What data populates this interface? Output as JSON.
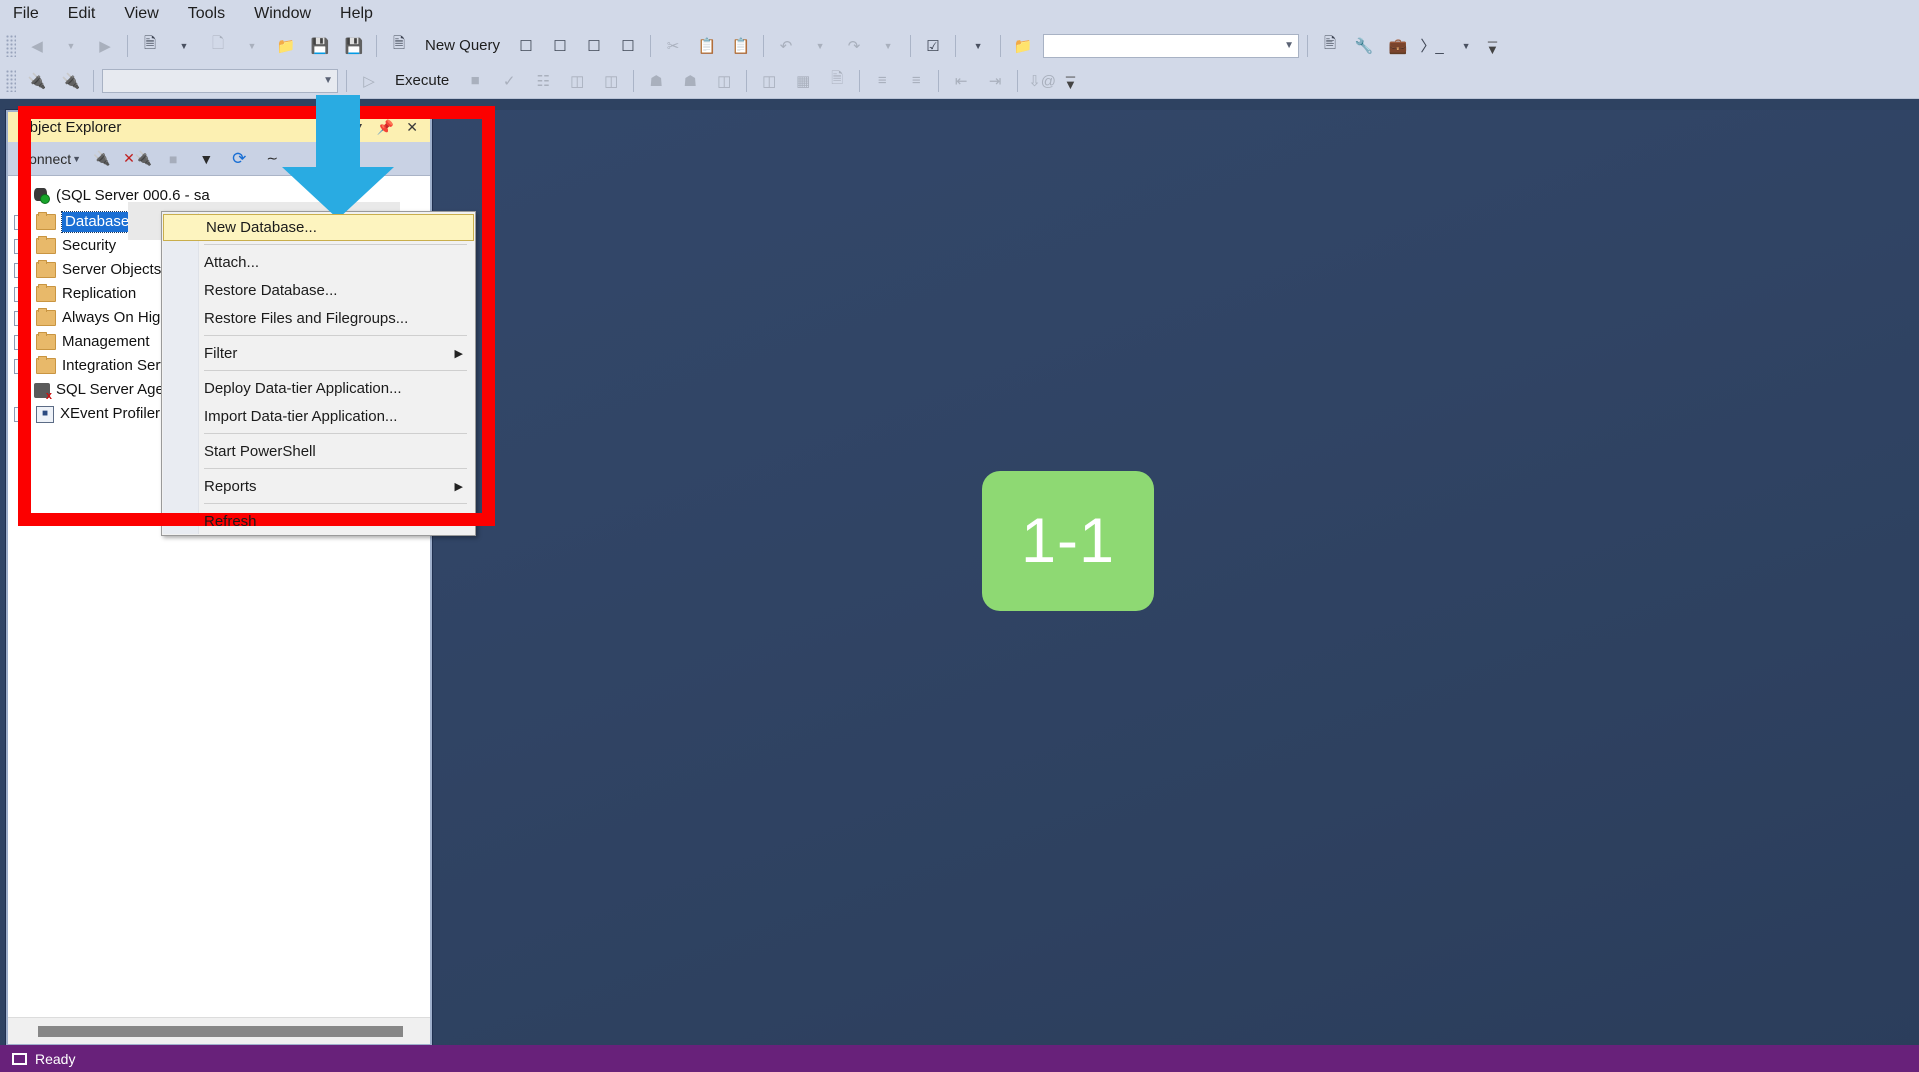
{
  "menubar": {
    "items": [
      "File",
      "Edit",
      "View",
      "Tools",
      "Window",
      "Help"
    ]
  },
  "toolbar_row1": {
    "new_query_label": "New Query",
    "icons": [
      "back-arrow-icon",
      "forward-arrow-icon",
      "new-project-icon",
      "new-item-icon",
      "open-file-icon",
      "save-icon",
      "save-all-icon",
      "new-query-icon",
      "mdx-query-icon",
      "dmx-query-icon",
      "xmla-query-icon",
      "dax-query-icon",
      "cut-icon",
      "copy-icon",
      "paste-icon",
      "undo-icon",
      "redo-icon",
      "solution-explorer-icon",
      "find-icon"
    ],
    "search_value": "",
    "right_icons": [
      "visual-studio-window-icon",
      "tools-wrench-icon",
      "toolbox-icon",
      "command-prompt-icon"
    ]
  },
  "toolbar_row2": {
    "execute_label": "Execute",
    "database_combo_value": "",
    "icons": [
      "connect-icon",
      "disconnect-icon",
      "execute-icon",
      "stop-icon",
      "parse-icon",
      "display-estimated-plan-icon",
      "include-actual-plan-icon",
      "include-client-statistics-icon",
      "query-options-icon",
      "results-to-text-icon",
      "results-to-grid-icon",
      "results-to-file-icon",
      "comment-icon",
      "uncomment-icon",
      "decrease-indent-icon",
      "increase-indent-icon",
      "specify-values-icon"
    ]
  },
  "object_explorer": {
    "title": "Object Explorer",
    "title_controls": [
      "chevron-down-icon",
      "pin-icon",
      "close-icon"
    ],
    "toolbar": {
      "connect_label": "Connect",
      "buttons": [
        "connect-plug-icon",
        "disconnect-plug-icon",
        "stop-icon",
        "filter-icon",
        "refresh-icon",
        "activity-monitor-icon"
      ]
    },
    "server_node": {
      "label": "(SQL Server 000.6 - sa"
    },
    "tree": [
      {
        "label": "Databases",
        "icon": "folder-icon",
        "expandable": true,
        "selected": true
      },
      {
        "label": "Security",
        "icon": "folder-icon",
        "expandable": true,
        "selected": false
      },
      {
        "label": "Server Objects",
        "icon": "folder-icon",
        "expandable": true,
        "selected": false
      },
      {
        "label": "Replication",
        "icon": "folder-icon",
        "expandable": true,
        "selected": false
      },
      {
        "label": "Always On High Availability",
        "icon": "folder-icon",
        "expandable": true,
        "selected": false
      },
      {
        "label": "Management",
        "icon": "folder-icon",
        "expandable": true,
        "selected": false
      },
      {
        "label": "Integration Services Catalogs",
        "icon": "folder-icon",
        "expandable": true,
        "selected": false
      },
      {
        "label": "SQL Server Agent",
        "icon": "sql-server-agent-icon",
        "expandable": false,
        "selected": false
      },
      {
        "label": "XEvent Profiler",
        "icon": "xevent-profiler-icon",
        "expandable": true,
        "selected": false
      }
    ]
  },
  "context_menu": {
    "items": [
      {
        "label": "New Database...",
        "highlighted": true,
        "submenu": false,
        "separator_after": true
      },
      {
        "label": "Attach...",
        "highlighted": false,
        "submenu": false,
        "separator_after": false
      },
      {
        "label": "Restore Database...",
        "highlighted": false,
        "submenu": false,
        "separator_after": false
      },
      {
        "label": "Restore Files and Filegroups...",
        "highlighted": false,
        "submenu": false,
        "separator_after": true
      },
      {
        "label": "Filter",
        "highlighted": false,
        "submenu": true,
        "separator_after": true
      },
      {
        "label": "Deploy Data-tier Application...",
        "highlighted": false,
        "submenu": false,
        "separator_after": false
      },
      {
        "label": "Import Data-tier Application...",
        "highlighted": false,
        "submenu": false,
        "separator_after": true
      },
      {
        "label": "Start PowerShell",
        "highlighted": false,
        "submenu": false,
        "separator_after": true
      },
      {
        "label": "Reports",
        "highlighted": false,
        "submenu": true,
        "separator_after": true
      },
      {
        "label": "Refresh",
        "highlighted": false,
        "submenu": false,
        "separator_after": false
      }
    ]
  },
  "annotations": {
    "step_badge": "1-1",
    "badge_color": "#8ed973",
    "highlight_box_color": "#fc0000",
    "arrow_color": "#29abe2",
    "arrow_name": "blue-down-arrow"
  },
  "statusbar": {
    "text": "Ready"
  }
}
